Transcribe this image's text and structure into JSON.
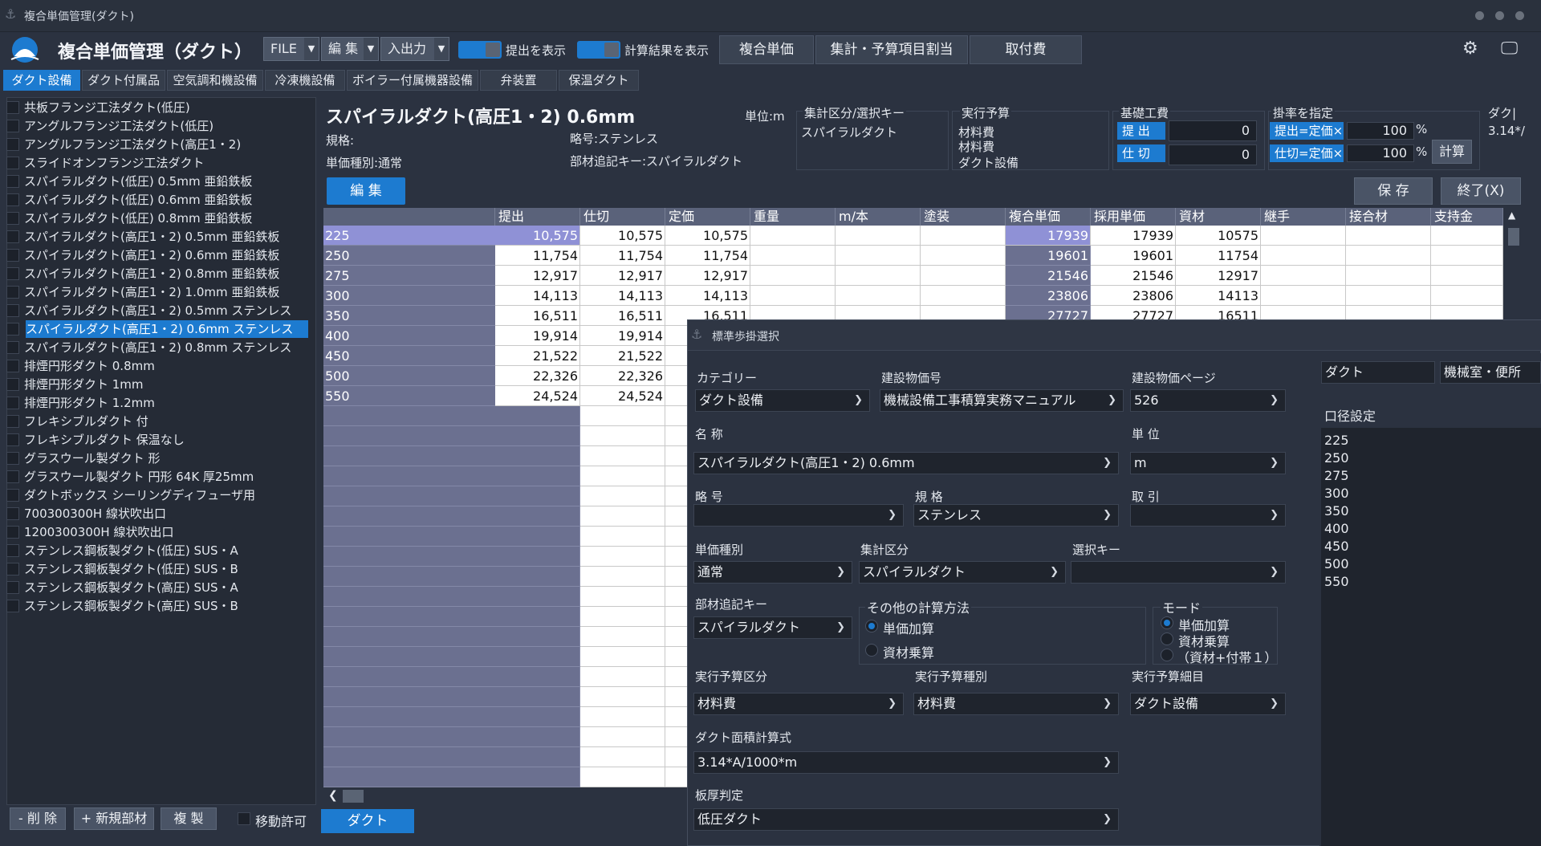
{
  "window": {
    "title": "複合単価管理(ダクト)"
  },
  "header": {
    "app_title": "複合単価管理（ダクト）",
    "file_menu": "FILE",
    "edit_menu": "編 集",
    "io_menu": "入出力",
    "toggle_submit": "提出を表示",
    "toggle_calc": "計算結果を表示",
    "btn_composite": "複合単価",
    "btn_budget": "集計・予算項目割当",
    "btn_install": "取付費"
  },
  "tabs": [
    "ダクト設備",
    "ダクト付属品",
    "空気調和機設備",
    "冷凍機設備",
    "ボイラー付属機器設備",
    "弁装置",
    "保温ダクト"
  ],
  "left_list": [
    "共板フランジ工法ダクト(低圧)",
    "アングルフランジ工法ダクト(低圧)",
    "アングルフランジ工法ダクト(高圧1・2)",
    "スライドオンフランジ工法ダクト",
    "スパイラルダクト(低圧) 0.5mm 亜鉛鉄板",
    "スパイラルダクト(低圧) 0.6mm 亜鉛鉄板",
    "スパイラルダクト(低圧) 0.8mm 亜鉛鉄板",
    "スパイラルダクト(高圧1・2) 0.5mm 亜鉛鉄板",
    "スパイラルダクト(高圧1・2) 0.6mm 亜鉛鉄板",
    "スパイラルダクト(高圧1・2) 0.8mm 亜鉛鉄板",
    "スパイラルダクト(高圧1・2) 1.0mm 亜鉛鉄板",
    "スパイラルダクト(高圧1・2) 0.5mm ステンレス",
    "スパイラルダクト(高圧1・2) 0.6mm ステンレス",
    "スパイラルダクト(高圧1・2) 0.8mm ステンレス",
    "排煙円形ダクト  0.8mm",
    "排煙円形ダクト  1mm",
    "排煙円形ダクト  1.2mm",
    "フレキシブルダクト 付",
    "フレキシブルダクト 保温なし",
    "グラスウール製ダクト 形",
    "グラスウール製ダクト 円形 64K 厚25mm",
    "ダクトボックス シーリングディフューザ用",
    "700300300H 線状吹出口",
    "1200300300H 線状吹出口",
    "ステンレス鋼板製ダクト(低圧) SUS・A",
    "ステンレス鋼板製ダクト(低圧) SUS・B",
    "ステンレス鋼板製ダクト(高圧) SUS・A",
    "ステンレス鋼板製ダクト(高圧) SUS・B"
  ],
  "left_buttons": {
    "delete": "- 削 除",
    "new": "+ 新規部材",
    "copy": "複 製",
    "move_allow": "移動許可"
  },
  "detail": {
    "title": "スパイラルダクト(高圧1・2) 0.6mm",
    "unit": "単位:m",
    "spec": "規格:",
    "abbr": "略号:ステンレス",
    "price_type": "単価種別:通常",
    "material_key": "部材追記キー:スパイラルダクト",
    "agg_label": "集計区分/選択キー",
    "agg_value": "スパイラルダクト",
    "budget_label": "実行予算",
    "budget_lines": [
      "材料費",
      "材料費",
      "ダクト設備"
    ],
    "labor_label": "基礎工費",
    "submit_tag": "提 出",
    "cut_tag": "仕 切",
    "labor_submit": "0",
    "labor_cut": "0",
    "rate_label": "掛率を指定",
    "rate_submit_tag": "提出=定価×",
    "rate_cut_tag": "仕切=定価×",
    "rate_submit": "100",
    "rate_cut": "100",
    "percent": "%",
    "calc_btn": "計算",
    "duct_label": "ダク|",
    "duct_formula": "3.14*/",
    "edit_btn": "編 集",
    "save_btn": "保 存",
    "exit_btn": "終了(X)"
  },
  "grid": {
    "columns": [
      "提出",
      "仕切",
      "定価",
      "重量",
      "m/本",
      "塗装",
      "複合単価",
      "採用単価",
      "資材",
      "継手",
      "接合材",
      "支持金"
    ],
    "rows": [
      {
        "size": "225",
        "submit": "10,575",
        "cut": "10,575",
        "list": "10,575",
        "comp": "17939",
        "adopt": "17939",
        "mat": "10575"
      },
      {
        "size": "250",
        "submit": "11,754",
        "cut": "11,754",
        "list": "11,754",
        "comp": "19601",
        "adopt": "19601",
        "mat": "11754"
      },
      {
        "size": "275",
        "submit": "12,917",
        "cut": "12,917",
        "list": "12,917",
        "comp": "21546",
        "adopt": "21546",
        "mat": "12917"
      },
      {
        "size": "300",
        "submit": "14,113",
        "cut": "14,113",
        "list": "14,113",
        "comp": "23806",
        "adopt": "23806",
        "mat": "14113"
      },
      {
        "size": "350",
        "submit": "16,511",
        "cut": "16,511",
        "list": "16,511",
        "comp": "27727",
        "adopt": "27727",
        "mat": "16511"
      },
      {
        "size": "400",
        "submit": "19,914",
        "cut": "19,914",
        "list": "",
        "comp": "",
        "adopt": "",
        "mat": ""
      },
      {
        "size": "450",
        "submit": "21,522",
        "cut": "21,522",
        "list": "",
        "comp": "",
        "adopt": "",
        "mat": ""
      },
      {
        "size": "500",
        "submit": "22,326",
        "cut": "22,326",
        "list": "",
        "comp": "",
        "adopt": "",
        "mat": ""
      },
      {
        "size": "550",
        "submit": "24,524",
        "cut": "24,524",
        "list": "",
        "comp": "",
        "adopt": "",
        "mat": ""
      }
    ]
  },
  "bottom_tab": "ダクト",
  "dialog": {
    "title": "標準歩掛選択",
    "category_label": "カテゴリー",
    "category": "ダクト設備",
    "source_label": "建設物価号",
    "source": "機械設備工事積算実務マニュアル",
    "page_label": "建設物価ページ",
    "page": "526",
    "name_label": "名 称",
    "name": "スパイラルダクト(高圧1・2) 0.6mm",
    "unit_label": "単 位",
    "unit": "m",
    "abbr_label": "略 号",
    "abbr": "",
    "spec_label": "規 格",
    "spec": "ステンレス",
    "deal_label": "取 引",
    "deal": "",
    "ptype_label": "単価種別",
    "ptype": "通常",
    "agg_label": "集計区分",
    "agg": "スパイラルダクト",
    "key_label": "選択キー",
    "key": "",
    "mkey_label": "部材追記キー",
    "mkey": "スパイラルダクト",
    "other_label": "その他の計算方法",
    "other_opts": [
      "単価加算",
      "資材乗算"
    ],
    "mode_label": "モード",
    "mode_opts": [
      "単価加算",
      "資材乗算",
      "（資材+付帯１）"
    ],
    "bdiv_label": "実行予算区分",
    "bdiv": "材料費",
    "btype_label": "実行予算種別",
    "btype": "材料費",
    "bdetail_label": "実行予算細目",
    "bdetail": "ダクト設備",
    "formula_label": "ダクト面積計算式",
    "formula": "3.14*A/1000*m",
    "plate_label": "板厚判定",
    "plate": "低圧ダクト"
  },
  "right_panel": {
    "field1": "ダクト",
    "field2": "機械室・便所",
    "size_label": "口径設定",
    "sizes": [
      "225",
      "250",
      "275",
      "300",
      "350",
      "400",
      "450",
      "500",
      "550"
    ]
  }
}
